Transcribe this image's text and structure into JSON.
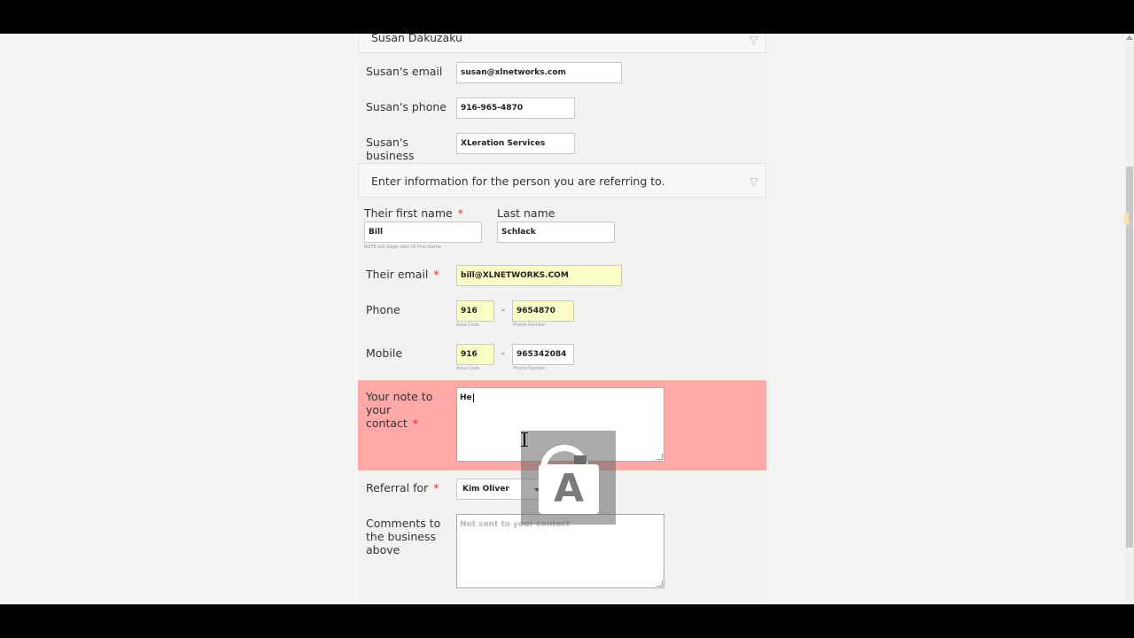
{
  "referrer": {
    "name_value": "Susan Dakuzaku",
    "email_label": "Susan's email",
    "email_value": "susan@xlnetworks.com",
    "phone_label": "Susan's phone",
    "phone_value": "916-965-4870",
    "business_label": "Susan's business",
    "business_value": "XLeration Services"
  },
  "section": {
    "title": "Enter information for the person you are referring to."
  },
  "contact": {
    "first_name_label": "Their first name",
    "first_name_value": "Bill",
    "first_name_note": "NOTE will begin with Hi First-Name",
    "last_name_label": "Last name",
    "last_name_value": "Schlack",
    "email_label": "Their email",
    "email_value": "bill@XLNETWORKS.COM",
    "phone_label": "Phone",
    "phone_area_value": "916",
    "phone_number_value": "9654870",
    "mobile_label": "Mobile",
    "mobile_area_value": "916",
    "mobile_number_value": "965342084",
    "area_code_sublabel": "Area Code",
    "phone_number_sublabel": "Phone Number",
    "dash": "-"
  },
  "note": {
    "label": "Your note to your contact",
    "value": "He"
  },
  "referral": {
    "label": "Referral for",
    "selected": "Kim Oliver"
  },
  "comments": {
    "label": "Comments to the business above",
    "placeholder": "Not sent to your contact"
  },
  "required_mark": "*",
  "overlay_letter": "A",
  "colors": {
    "error_bg": "#ffa8a8",
    "autofill_yellow": "#fbfdc6",
    "required_red": "#d9322e"
  }
}
